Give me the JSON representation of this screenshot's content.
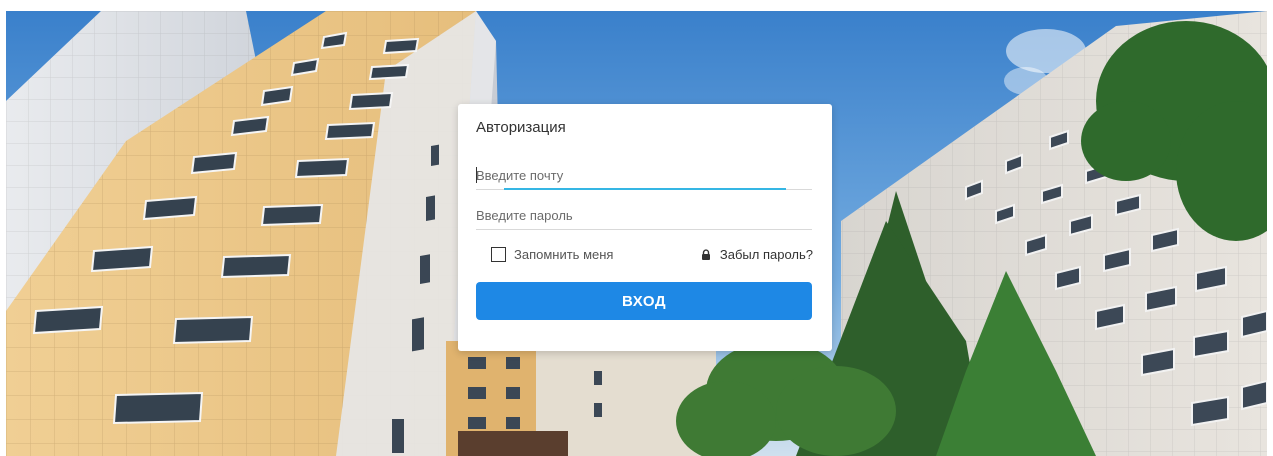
{
  "login": {
    "title": "Авторизация",
    "email_placeholder": "Введите почту",
    "password_placeholder": "Введите пароль",
    "remember_label": "Запомнить меня",
    "forgot_label": "Забыл пароль?",
    "submit_label": "ВХОД"
  },
  "colors": {
    "button": "#1e88e5",
    "focus_underline": "#35b6e4",
    "sky": "#4b8fd4"
  },
  "icons": {
    "forgot": "lock-icon",
    "remember": "checkbox"
  }
}
